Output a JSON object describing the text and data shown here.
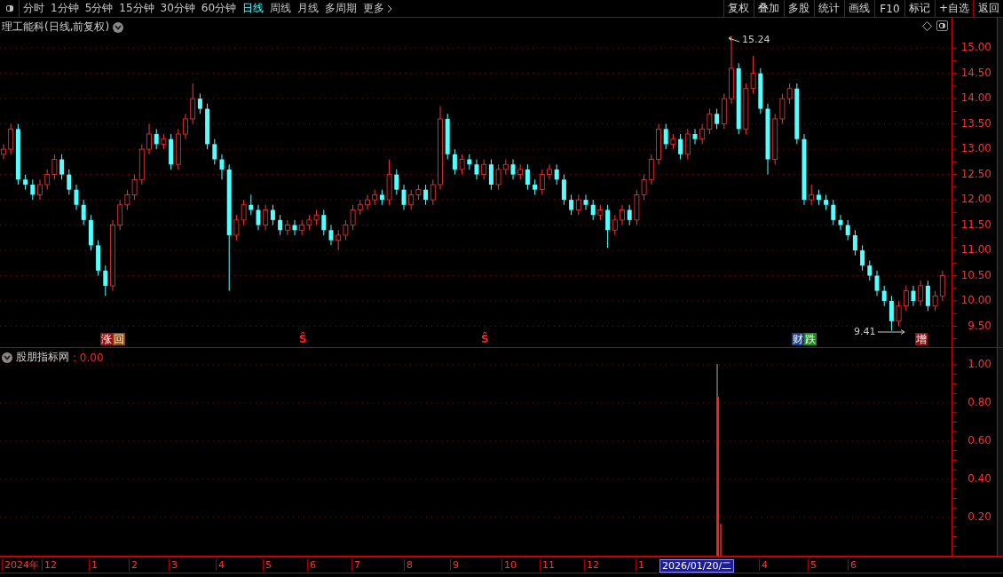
{
  "toolbar": {
    "periods": [
      {
        "label": "分时",
        "selected": false
      },
      {
        "label": "1分钟",
        "selected": false
      },
      {
        "label": "5分钟",
        "selected": false
      },
      {
        "label": "15分钟",
        "selected": false
      },
      {
        "label": "30分钟",
        "selected": false
      },
      {
        "label": "60分钟",
        "selected": false
      },
      {
        "label": "日线",
        "selected": true
      },
      {
        "label": "周线",
        "selected": false
      },
      {
        "label": "月线",
        "selected": false
      },
      {
        "label": "多周期",
        "selected": false
      },
      {
        "label": "更多",
        "selected": false
      }
    ],
    "actions": [
      "复权",
      "叠加",
      "多股",
      "统计",
      "画线",
      "F10",
      "标记",
      "+自选",
      "返回"
    ]
  },
  "main": {
    "title": "理工能科(日线,前复权)",
    "high_label": "15.24",
    "low_label": "9.41",
    "chart_data": {
      "type": "candlestick",
      "grid": true,
      "ylim": [
        4.98,
        15.6
      ],
      "yticks": [
        {
          "value": 15,
          "label": "15.00"
        },
        {
          "value": 14.5,
          "label": "14.50"
        },
        {
          "value": 14,
          "label": "14.00"
        },
        {
          "value": 13.5,
          "label": "13.50"
        },
        {
          "value": 13,
          "label": "13.00"
        },
        {
          "value": 12.5,
          "label": "12.50"
        },
        {
          "value": 12,
          "label": "12.00"
        },
        {
          "value": 11.5,
          "label": "11.50"
        },
        {
          "value": 11,
          "label": "11.00"
        },
        {
          "value": 10.5,
          "label": "10.50"
        },
        {
          "value": 10,
          "label": "10.00"
        },
        {
          "value": 9.5,
          "label": "9.50"
        }
      ],
      "ohlc": [
        [
          12.9,
          13.1,
          12.8,
          13.0
        ],
        [
          13.0,
          13.5,
          12.9,
          13.4
        ],
        [
          13.4,
          13.5,
          12.3,
          12.4
        ],
        [
          12.4,
          12.5,
          12.2,
          12.3
        ],
        [
          12.3,
          12.4,
          12.0,
          12.1
        ],
        [
          12.1,
          12.4,
          12.0,
          12.3
        ],
        [
          12.3,
          12.6,
          12.2,
          12.5
        ],
        [
          12.5,
          12.9,
          12.4,
          12.8
        ],
        [
          12.8,
          12.9,
          12.4,
          12.5
        ],
        [
          12.5,
          12.6,
          12.1,
          12.2
        ],
        [
          12.2,
          12.3,
          11.8,
          11.9
        ],
        [
          11.9,
          12.0,
          11.5,
          11.6
        ],
        [
          11.6,
          11.7,
          11.0,
          11.1
        ],
        [
          11.1,
          11.2,
          10.5,
          10.6
        ],
        [
          10.6,
          10.7,
          10.1,
          10.3
        ],
        [
          10.3,
          11.6,
          10.2,
          11.5
        ],
        [
          11.5,
          12.0,
          11.4,
          11.9
        ],
        [
          11.9,
          12.2,
          11.8,
          12.1
        ],
        [
          12.1,
          12.5,
          12.0,
          12.4
        ],
        [
          12.4,
          13.1,
          12.3,
          13.0
        ],
        [
          13.0,
          13.5,
          12.9,
          13.3
        ],
        [
          13.3,
          13.4,
          13.0,
          13.1
        ],
        [
          13.1,
          13.3,
          13.0,
          13.2
        ],
        [
          13.2,
          13.3,
          12.6,
          12.7
        ],
        [
          12.7,
          13.4,
          12.6,
          13.3
        ],
        [
          13.3,
          13.7,
          13.2,
          13.6
        ],
        [
          13.6,
          14.3,
          13.5,
          14.0
        ],
        [
          14.0,
          14.1,
          13.7,
          13.8
        ],
        [
          13.8,
          13.9,
          13.0,
          13.1
        ],
        [
          13.1,
          13.2,
          12.7,
          12.8
        ],
        [
          12.8,
          12.9,
          12.4,
          12.6
        ],
        [
          12.6,
          12.7,
          10.2,
          11.3
        ],
        [
          11.3,
          11.7,
          11.2,
          11.6
        ],
        [
          11.6,
          12.0,
          11.5,
          11.9
        ],
        [
          11.9,
          12.1,
          11.7,
          11.8
        ],
        [
          11.8,
          11.9,
          11.4,
          11.5
        ],
        [
          11.5,
          11.9,
          11.4,
          11.8
        ],
        [
          11.8,
          11.9,
          11.5,
          11.6
        ],
        [
          11.6,
          11.7,
          11.3,
          11.4
        ],
        [
          11.4,
          11.6,
          11.3,
          11.5
        ],
        [
          11.5,
          11.6,
          11.3,
          11.4
        ],
        [
          11.4,
          11.6,
          11.3,
          11.5
        ],
        [
          11.5,
          11.7,
          11.4,
          11.6
        ],
        [
          11.6,
          11.8,
          11.5,
          11.7
        ],
        [
          11.7,
          11.8,
          11.3,
          11.4
        ],
        [
          11.4,
          11.5,
          11.1,
          11.2
        ],
        [
          11.2,
          11.4,
          11.0,
          11.3
        ],
        [
          11.3,
          11.6,
          11.2,
          11.5
        ],
        [
          11.5,
          11.9,
          11.4,
          11.8
        ],
        [
          11.8,
          12.0,
          11.7,
          11.9
        ],
        [
          11.9,
          12.1,
          11.8,
          12.0
        ],
        [
          12.0,
          12.2,
          11.9,
          12.1
        ],
        [
          12.1,
          12.2,
          11.9,
          12.0
        ],
        [
          12.0,
          12.8,
          11.9,
          12.5
        ],
        [
          12.5,
          12.6,
          12.1,
          12.2
        ],
        [
          12.2,
          12.3,
          11.8,
          11.9
        ],
        [
          11.9,
          12.2,
          11.8,
          12.1
        ],
        [
          12.1,
          12.3,
          12.0,
          12.2
        ],
        [
          12.2,
          12.3,
          11.9,
          12.0
        ],
        [
          12.0,
          12.4,
          11.9,
          12.3
        ],
        [
          12.3,
          13.85,
          12.2,
          13.6
        ],
        [
          13.6,
          13.7,
          12.8,
          12.9
        ],
        [
          12.9,
          13.0,
          12.5,
          12.6
        ],
        [
          12.6,
          12.9,
          12.5,
          12.8
        ],
        [
          12.8,
          12.9,
          12.6,
          12.7
        ],
        [
          12.7,
          12.8,
          12.4,
          12.5
        ],
        [
          12.5,
          12.8,
          12.4,
          12.7
        ],
        [
          12.7,
          12.8,
          12.2,
          12.3
        ],
        [
          12.3,
          12.7,
          12.2,
          12.6
        ],
        [
          12.6,
          12.8,
          12.5,
          12.7
        ],
        [
          12.7,
          12.8,
          12.4,
          12.5
        ],
        [
          12.5,
          12.7,
          12.4,
          12.6
        ],
        [
          12.6,
          12.7,
          12.2,
          12.3
        ],
        [
          12.3,
          12.4,
          12.1,
          12.2
        ],
        [
          12.2,
          12.6,
          12.1,
          12.5
        ],
        [
          12.5,
          12.7,
          12.4,
          12.6
        ],
        [
          12.6,
          12.7,
          12.3,
          12.4
        ],
        [
          12.4,
          12.5,
          11.9,
          12.0
        ],
        [
          12.0,
          12.1,
          11.7,
          11.8
        ],
        [
          11.8,
          12.1,
          11.7,
          12.0
        ],
        [
          12.0,
          12.1,
          11.8,
          11.9
        ],
        [
          11.9,
          12.0,
          11.6,
          11.7
        ],
        [
          11.7,
          11.9,
          11.6,
          11.8
        ],
        [
          11.8,
          11.9,
          11.05,
          11.4
        ],
        [
          11.4,
          11.7,
          11.3,
          11.6
        ],
        [
          11.6,
          11.9,
          11.5,
          11.8
        ],
        [
          11.8,
          11.9,
          11.5,
          11.6
        ],
        [
          11.6,
          12.2,
          11.5,
          12.1
        ],
        [
          12.1,
          12.5,
          12.0,
          12.4
        ],
        [
          12.4,
          12.9,
          12.3,
          12.8
        ],
        [
          12.8,
          13.5,
          12.7,
          13.4
        ],
        [
          13.4,
          13.5,
          13.0,
          13.1
        ],
        [
          13.1,
          13.3,
          13.0,
          13.2
        ],
        [
          13.2,
          13.3,
          12.8,
          12.9
        ],
        [
          12.9,
          13.4,
          12.8,
          13.3
        ],
        [
          13.3,
          13.4,
          13.1,
          13.2
        ],
        [
          13.2,
          13.5,
          13.1,
          13.4
        ],
        [
          13.4,
          13.8,
          13.3,
          13.7
        ],
        [
          13.7,
          13.8,
          13.4,
          13.5
        ],
        [
          13.5,
          14.1,
          13.4,
          14.0
        ],
        [
          14.0,
          15.24,
          13.9,
          14.6
        ],
        [
          14.6,
          14.7,
          13.3,
          13.4
        ],
        [
          13.4,
          14.3,
          13.3,
          14.2
        ],
        [
          14.2,
          14.85,
          14.1,
          14.5
        ],
        [
          14.5,
          14.6,
          13.7,
          13.8
        ],
        [
          13.8,
          13.9,
          12.5,
          12.8
        ],
        [
          12.8,
          13.7,
          12.7,
          13.6
        ],
        [
          13.6,
          14.1,
          13.5,
          14.0
        ],
        [
          14.0,
          14.3,
          13.9,
          14.2
        ],
        [
          14.2,
          14.3,
          13.1,
          13.2
        ],
        [
          13.2,
          13.3,
          11.9,
          12.0
        ],
        [
          12.0,
          12.3,
          11.9,
          12.1
        ],
        [
          12.1,
          12.2,
          11.9,
          12.0
        ],
        [
          12.0,
          12.1,
          11.8,
          11.9
        ],
        [
          11.9,
          12.0,
          11.5,
          11.6
        ],
        [
          11.6,
          11.7,
          11.4,
          11.5
        ],
        [
          11.5,
          11.6,
          11.2,
          11.3
        ],
        [
          11.3,
          11.4,
          10.9,
          11.0
        ],
        [
          11.0,
          11.1,
          10.6,
          10.7
        ],
        [
          10.7,
          10.8,
          10.4,
          10.5
        ],
        [
          10.5,
          10.6,
          10.1,
          10.2
        ],
        [
          10.2,
          10.3,
          9.9,
          10.0
        ],
        [
          10.0,
          10.1,
          9.41,
          9.6
        ],
        [
          9.6,
          10.0,
          9.5,
          9.9
        ],
        [
          9.9,
          10.3,
          9.8,
          10.2
        ],
        [
          10.2,
          10.3,
          9.9,
          10.0
        ],
        [
          10.0,
          10.4,
          9.9,
          10.3
        ],
        [
          10.3,
          10.4,
          9.8,
          9.9
        ],
        [
          9.9,
          10.2,
          9.8,
          10.1
        ],
        [
          10.1,
          10.6,
          10.0,
          10.5
        ]
      ]
    },
    "markers": [
      {
        "kind": "badge",
        "segments": [
          {
            "text": "涨",
            "color": "#8b1414"
          },
          {
            "text": "回",
            "color": "#8a4a14"
          }
        ]
      },
      {
        "kind": "letter",
        "segments": [
          {
            "text": "Ŝ",
            "color": "#ff2020"
          }
        ]
      },
      {
        "kind": "letter",
        "segments": [
          {
            "text": "Ŝ",
            "color": "#ff2020"
          }
        ]
      },
      {
        "kind": "badge",
        "segments": [
          {
            "text": "财",
            "color": "#1c3c8c"
          },
          {
            "text": "跌",
            "color": "#1c8c1c"
          }
        ]
      },
      {
        "kind": "badge",
        "segments": [
          {
            "text": "增",
            "color": "#8b1414"
          }
        ]
      }
    ]
  },
  "indicator": {
    "title": "股朋指标网",
    "value": ": 0.00",
    "yticks": [
      "1.00",
      "0.80",
      "0.60",
      "0.40",
      "0.20"
    ]
  },
  "date_axis": {
    "labels": [
      {
        "text": "2024年",
        "selected": false
      },
      {
        "text": "12",
        "selected": false
      },
      {
        "text": "1",
        "selected": false
      },
      {
        "text": "2",
        "selected": false
      },
      {
        "text": "3",
        "selected": false
      },
      {
        "text": "4",
        "selected": false
      },
      {
        "text": "5",
        "selected": false
      },
      {
        "text": "6",
        "selected": false
      },
      {
        "text": "7",
        "selected": false
      },
      {
        "text": "8",
        "selected": false
      },
      {
        "text": "9",
        "selected": false
      },
      {
        "text": "10",
        "selected": false
      },
      {
        "text": "11",
        "selected": false
      },
      {
        "text": "12",
        "selected": false
      },
      {
        "text": "1",
        "selected": false
      },
      {
        "text": "2026/01/20/二",
        "selected": true
      },
      {
        "text": "4",
        "selected": false
      },
      {
        "text": "5",
        "selected": false
      },
      {
        "text": "6",
        "selected": false
      }
    ]
  }
}
